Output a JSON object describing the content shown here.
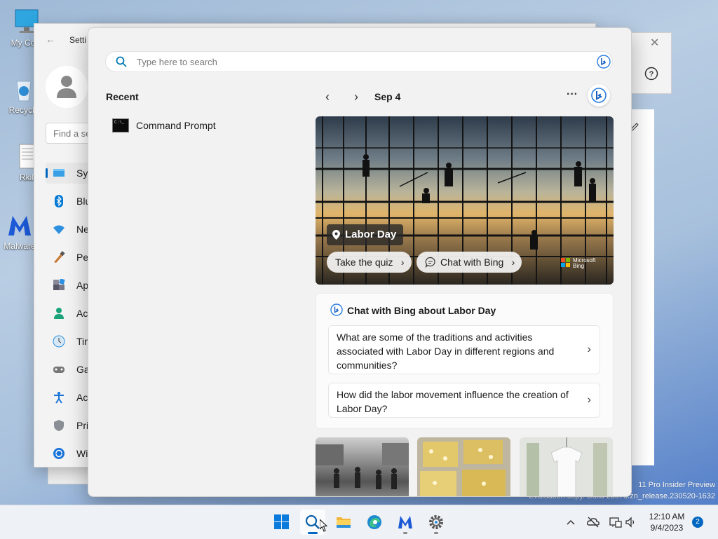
{
  "desktop": {
    "icons": [
      {
        "label": "My Com"
      },
      {
        "label": "Recycle"
      },
      {
        "label": "Rkil"
      },
      {
        "label": "Malware"
      }
    ]
  },
  "settings": {
    "title": "Setti",
    "find_placeholder": "Find a se",
    "nav": [
      {
        "label": "Sys",
        "icon": "system-icon"
      },
      {
        "label": "Blu",
        "icon": "bluetooth-icon"
      },
      {
        "label": "Ne",
        "icon": "network-icon"
      },
      {
        "label": "Per",
        "icon": "personalization-icon"
      },
      {
        "label": "Ap",
        "icon": "apps-icon"
      },
      {
        "label": "Ac",
        "icon": "accounts-icon"
      },
      {
        "label": "Tin",
        "icon": "time-icon"
      },
      {
        "label": "Ga",
        "icon": "gaming-icon"
      },
      {
        "label": "Ac",
        "icon": "accessibility-icon"
      },
      {
        "label": "Pri",
        "icon": "privacy-icon"
      },
      {
        "label": "Wi",
        "icon": "windows-update-icon"
      }
    ]
  },
  "search": {
    "placeholder": "Type here to search",
    "recent_heading": "Recent",
    "recent_items": [
      {
        "label": "Command Prompt"
      }
    ],
    "date": "Sep 4",
    "more": "···",
    "hero": {
      "tag": "Labor Day",
      "quiz_label": "Take the quiz",
      "chat_label": "Chat with Bing",
      "brand": "Microsoft Bing"
    },
    "chat_card": {
      "heading": "Chat with Bing about Labor Day",
      "questions": [
        "What are some of the traditions and activities associated with Labor Day in different regions and communities?",
        "How did the labor movement influence the creation of Labor Day?"
      ]
    }
  },
  "watermark": {
    "line1": "11 Pro Insider Preview",
    "line2": "Evaluation copy. Build 23575.zn_release.230520-1632"
  },
  "taskbar": {
    "time": "12:10 AM",
    "date": "9/4/2023",
    "notifications": "2"
  },
  "colors": {
    "accent": "#0067c0"
  }
}
